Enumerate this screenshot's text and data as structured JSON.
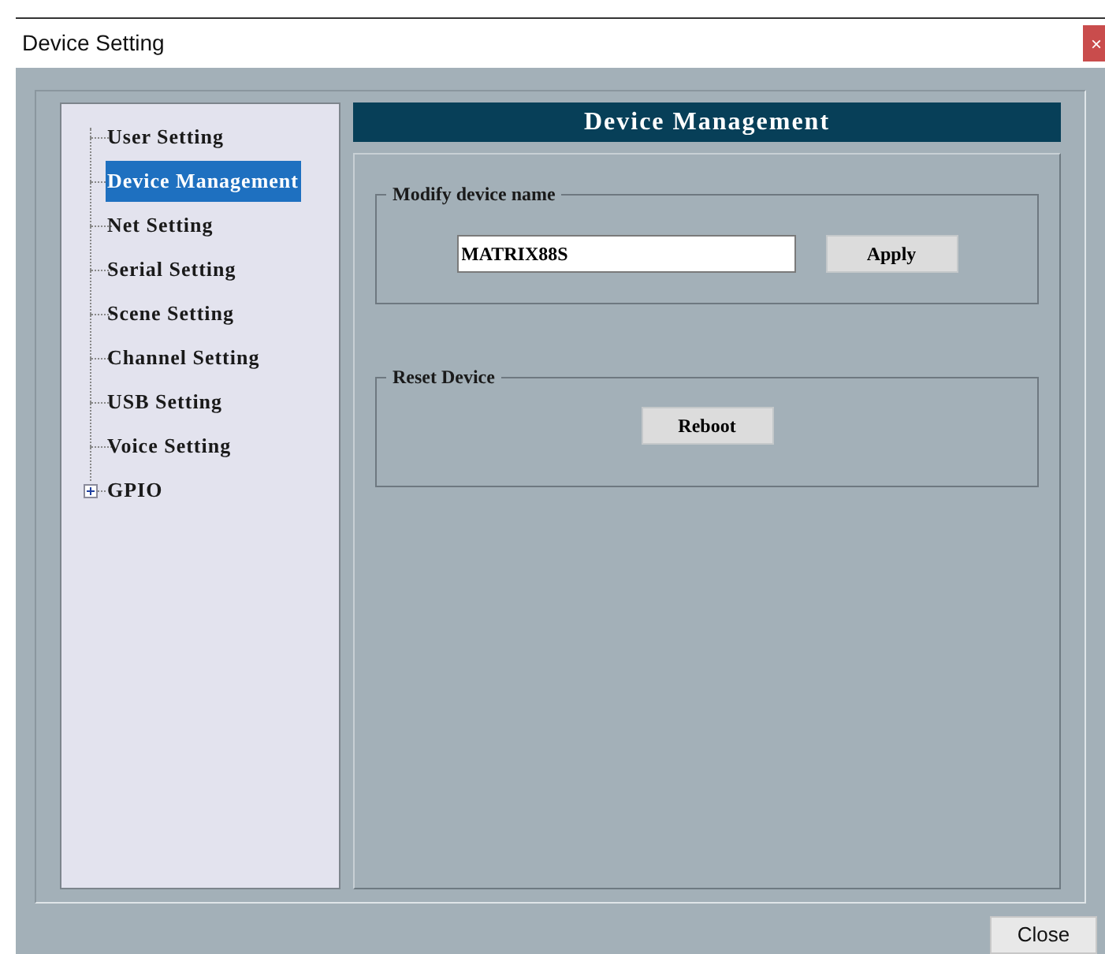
{
  "window": {
    "title": "Device Setting",
    "close_glyph": "×"
  },
  "tree": [
    {
      "label": "User Setting",
      "kind": "leaf",
      "selected": false
    },
    {
      "label": "Device Management",
      "kind": "leaf",
      "selected": true
    },
    {
      "label": "Net Setting",
      "kind": "leaf",
      "selected": false
    },
    {
      "label": "Serial Setting",
      "kind": "leaf",
      "selected": false
    },
    {
      "label": "Scene Setting",
      "kind": "leaf",
      "selected": false
    },
    {
      "label": "Channel Setting",
      "kind": "leaf",
      "selected": false
    },
    {
      "label": "USB Setting",
      "kind": "leaf",
      "selected": false
    },
    {
      "label": "Voice Setting",
      "kind": "leaf",
      "selected": false
    },
    {
      "label": "GPIO",
      "kind": "folder",
      "selected": false,
      "expanded": false
    }
  ],
  "panel": {
    "title": "Device Management",
    "groups": [
      {
        "title": "Modify device name",
        "field": {
          "value": "MATRIX88S"
        },
        "button": "Apply"
      },
      {
        "title": "Reset Device",
        "button": "Reboot"
      }
    ]
  },
  "footer": {
    "button": "Close"
  }
}
